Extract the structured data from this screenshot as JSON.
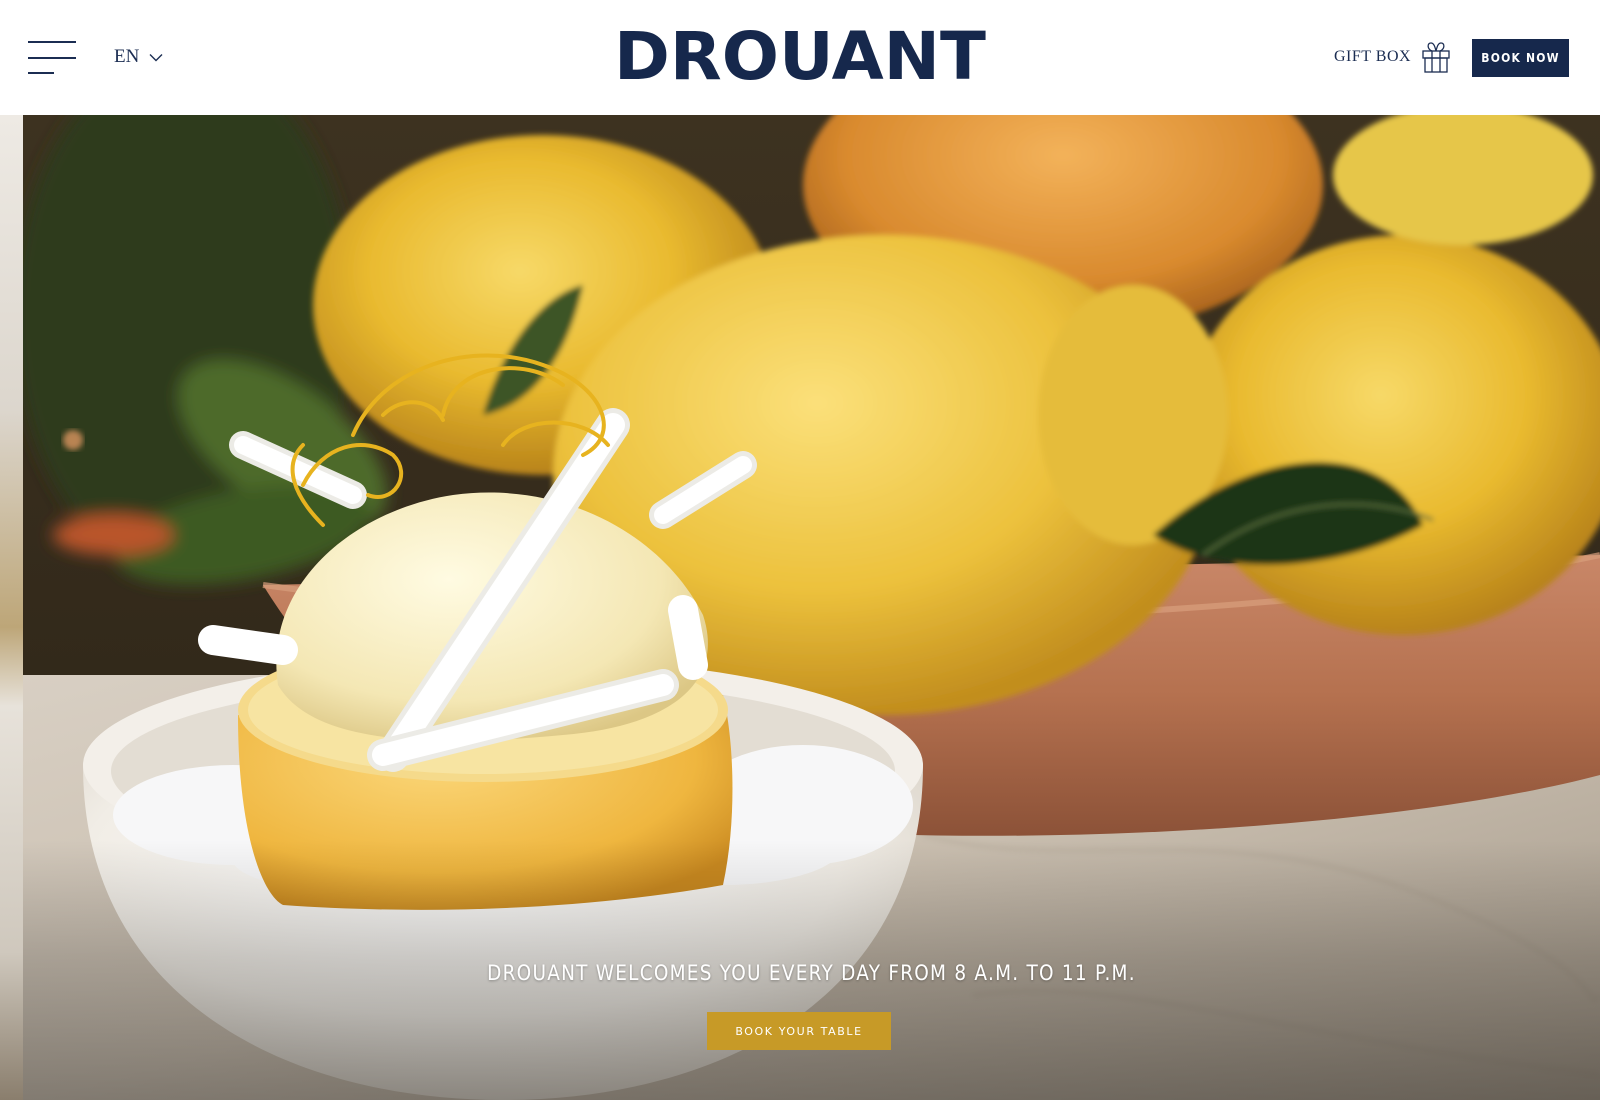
{
  "header": {
    "menu_icon": "hamburger-menu-icon",
    "language": "EN",
    "language_icon": "chevron-down-icon",
    "logo": "DROUANT",
    "gift_label": "GIFT BOX",
    "gift_icon": "gift-icon",
    "book_now_label": "BOOK NOW"
  },
  "hero": {
    "caption": "DROUANT WELCOMES YOU EVERY DAY FROM 8 A.M. TO 11 P.M.",
    "cta_label": "BOOK YOUR TABLE"
  },
  "colors": {
    "navy": "#16284c",
    "gold": "#c79a27",
    "white": "#ffffff"
  }
}
